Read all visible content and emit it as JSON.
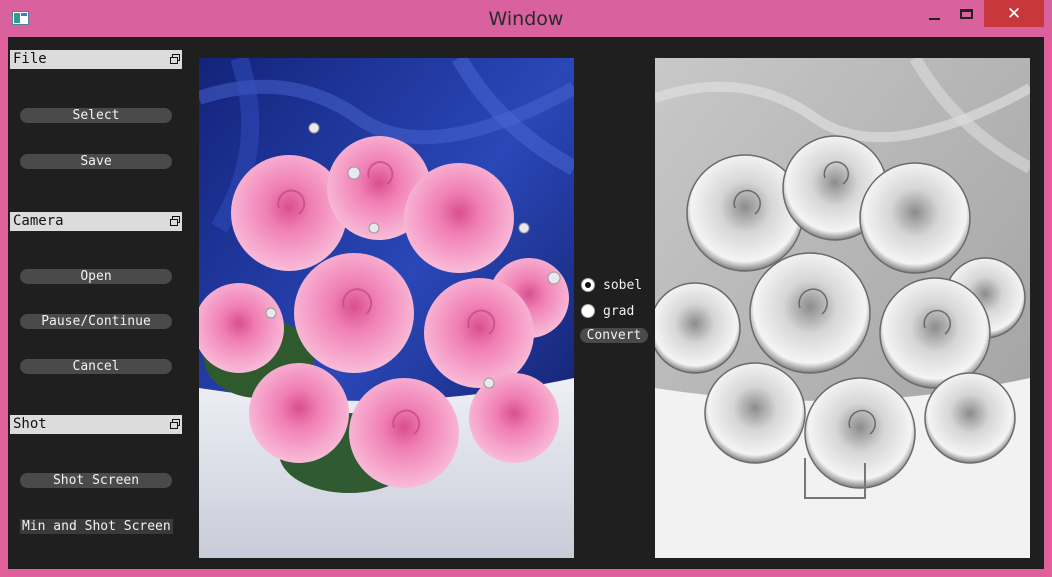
{
  "window": {
    "title": "Window",
    "close_glyph": "✕"
  },
  "docks": {
    "file": {
      "title": "File",
      "buttons": [
        "Select",
        "Save"
      ]
    },
    "camera": {
      "title": "Camera",
      "buttons": [
        "Open",
        "Pause/Continue",
        "Cancel"
      ]
    },
    "shot": {
      "title": "Shot",
      "buttons": [
        "Shot Screen",
        "Min and Shot Screen"
      ]
    }
  },
  "controls": {
    "radio_sobel": {
      "label": "sobel",
      "checked": true
    },
    "radio_grad": {
      "label": "grad",
      "checked": false
    },
    "convert_label": "Convert"
  },
  "images": {
    "source": "rose-bouquet-photo",
    "result": "rose-bouquet-edge-sketch"
  },
  "colors": {
    "titlebar": "#d9619d",
    "client_bg": "#1f1f1f",
    "close_button": "#c7373b",
    "dock_title_bg": "#dcdcdc",
    "button_bg": "#4a4a4a"
  }
}
